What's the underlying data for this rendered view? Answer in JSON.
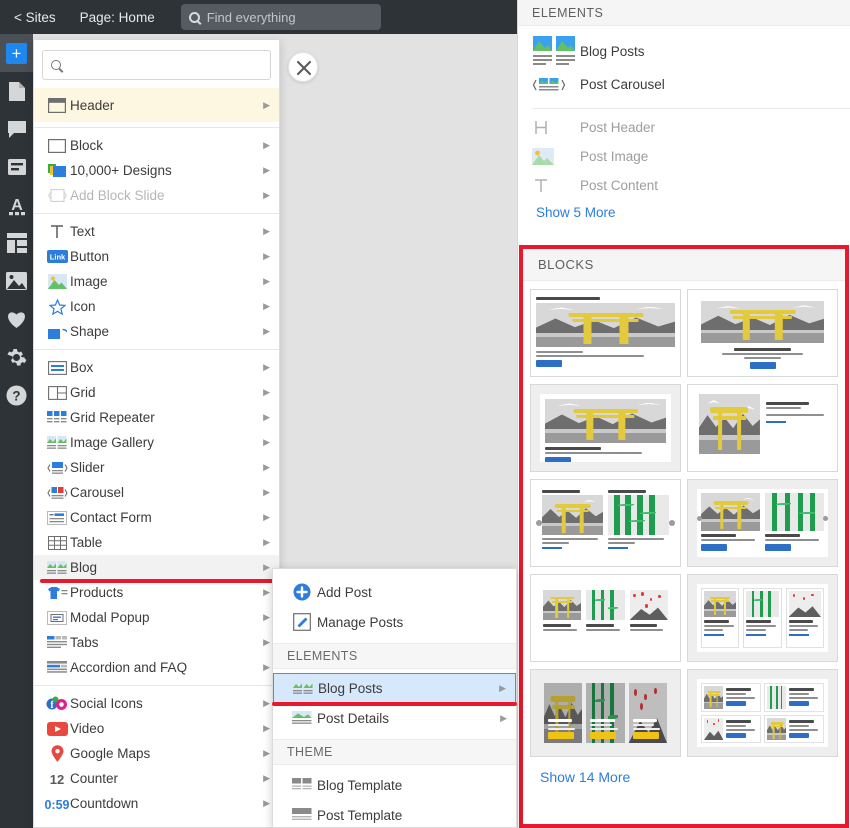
{
  "topbar": {
    "sites_label": "< Sites",
    "page_label": "Page: Home",
    "search_placeholder": "Find everything",
    "search_icon": "search-icon"
  },
  "rail": {
    "items": [
      {
        "icon": "plus-icon",
        "name": "add-element"
      },
      {
        "icon": "page-icon",
        "name": "pages"
      },
      {
        "icon": "comment-icon",
        "name": "comments"
      },
      {
        "icon": "list-icon",
        "name": "layers"
      },
      {
        "icon": "typography-icon",
        "name": "typography"
      },
      {
        "icon": "layout-icon",
        "name": "layout"
      },
      {
        "icon": "image-icon",
        "name": "media"
      },
      {
        "icon": "heart-icon",
        "name": "favorites"
      },
      {
        "icon": "gear-icon",
        "name": "settings"
      },
      {
        "icon": "help-icon",
        "name": "help"
      }
    ]
  },
  "panel": {
    "search_placeholder": "",
    "close_icon": "close-icon",
    "header_item": {
      "label": "Header",
      "icon": "header-icon"
    },
    "groups": [
      {
        "items": [
          {
            "label": "Block",
            "icon": "block-icon",
            "dim": false
          },
          {
            "label": "10,000+ Designs",
            "icon": "designs-icon",
            "dim": false
          },
          {
            "label": "Add Block Slide",
            "icon": "slide-icon",
            "dim": true
          }
        ]
      },
      {
        "items": [
          {
            "label": "Text",
            "icon": "text-icon",
            "dim": false
          },
          {
            "label": "Button",
            "icon": "button-icon",
            "dim": false
          },
          {
            "label": "Image",
            "icon": "image-icon",
            "dim": false
          },
          {
            "label": "Icon",
            "icon": "star-icon",
            "dim": false
          },
          {
            "label": "Shape",
            "icon": "shape-icon",
            "dim": false
          }
        ]
      },
      {
        "items": [
          {
            "label": "Box",
            "icon": "box-icon",
            "dim": false
          },
          {
            "label": "Grid",
            "icon": "grid-icon",
            "dim": false
          },
          {
            "label": "Grid Repeater",
            "icon": "grid-repeater-icon",
            "dim": false
          },
          {
            "label": "Image Gallery",
            "icon": "gallery-icon",
            "dim": false
          },
          {
            "label": "Slider",
            "icon": "slider-icon",
            "dim": false
          },
          {
            "label": "Carousel",
            "icon": "carousel-icon",
            "dim": false
          },
          {
            "label": "Contact Form",
            "icon": "form-icon",
            "dim": false
          },
          {
            "label": "Table",
            "icon": "table-icon",
            "dim": false
          },
          {
            "label": "Blog",
            "icon": "blog-icon",
            "dim": false,
            "highlighted": true
          },
          {
            "label": "Products",
            "icon": "products-icon",
            "dim": false
          },
          {
            "label": "Modal Popup",
            "icon": "modal-icon",
            "dim": false
          },
          {
            "label": "Tabs",
            "icon": "tabs-icon",
            "dim": false
          },
          {
            "label": "Accordion and FAQ",
            "icon": "accordion-icon",
            "dim": false
          }
        ]
      },
      {
        "items": [
          {
            "label": "Social Icons",
            "icon": "social-icon",
            "dim": false
          },
          {
            "label": "Video",
            "icon": "video-icon",
            "dim": false
          },
          {
            "label": "Google Maps",
            "icon": "map-pin-icon",
            "dim": false
          },
          {
            "label": "Counter",
            "icon": "counter-icon",
            "dim": false
          },
          {
            "label": "Countdown",
            "icon": "countdown-icon",
            "dim": false
          }
        ]
      }
    ]
  },
  "submenu": {
    "actions": [
      {
        "label": "Add Post",
        "icon": "plus-circle-icon"
      },
      {
        "label": "Manage Posts",
        "icon": "edit-icon"
      }
    ],
    "elements_header": "ELEMENTS",
    "elements": [
      {
        "label": "Blog Posts",
        "icon": "blog-posts-icon",
        "selected": true
      },
      {
        "label": "Post Details",
        "icon": "post-details-icon",
        "selected": false
      }
    ],
    "theme_header": "THEME",
    "theme": [
      {
        "label": "Blog Template",
        "icon": "blog-template-icon"
      },
      {
        "label": "Post Template",
        "icon": "post-template-icon"
      }
    ]
  },
  "right_panel": {
    "elements_header": "ELEMENTS",
    "primary": [
      {
        "label": "Blog Posts",
        "icon": "blog-posts-icon"
      },
      {
        "label": "Post Carousel",
        "icon": "post-carousel-icon"
      }
    ],
    "secondary": [
      {
        "label": "Post Header",
        "icon": "post-header-icon"
      },
      {
        "label": "Post Image",
        "icon": "post-image-icon"
      },
      {
        "label": "Post Content",
        "icon": "post-content-icon"
      }
    ],
    "show_more_elements": "Show 5 More",
    "blocks_header": "BLOCKS",
    "blocks": [
      {
        "id": 1,
        "layout": "image-top-single",
        "highlight": false
      },
      {
        "id": 2,
        "layout": "image-top-centered",
        "highlight": false
      },
      {
        "id": 3,
        "layout": "image-framed-single",
        "highlight": true
      },
      {
        "id": 4,
        "layout": "image-left-text-right",
        "highlight": false
      },
      {
        "id": 5,
        "layout": "two-column-slider",
        "highlight": false
      },
      {
        "id": 6,
        "layout": "two-column-cards",
        "highlight": true
      },
      {
        "id": 7,
        "layout": "three-column-plain",
        "highlight": false
      },
      {
        "id": 8,
        "layout": "three-column-cards",
        "highlight": true
      },
      {
        "id": 9,
        "layout": "three-column-overlay",
        "highlight": true
      },
      {
        "id": 10,
        "layout": "four-card-list",
        "highlight": true
      }
    ],
    "show_more_blocks": "Show 14 More"
  },
  "colors": {
    "accent_red": "#e8192c",
    "accent_blue": "#2b7de0",
    "topbar_bg": "#2e3338",
    "header_highlight": "#fdf6e0",
    "selected_blue": "#d6e8fb"
  }
}
